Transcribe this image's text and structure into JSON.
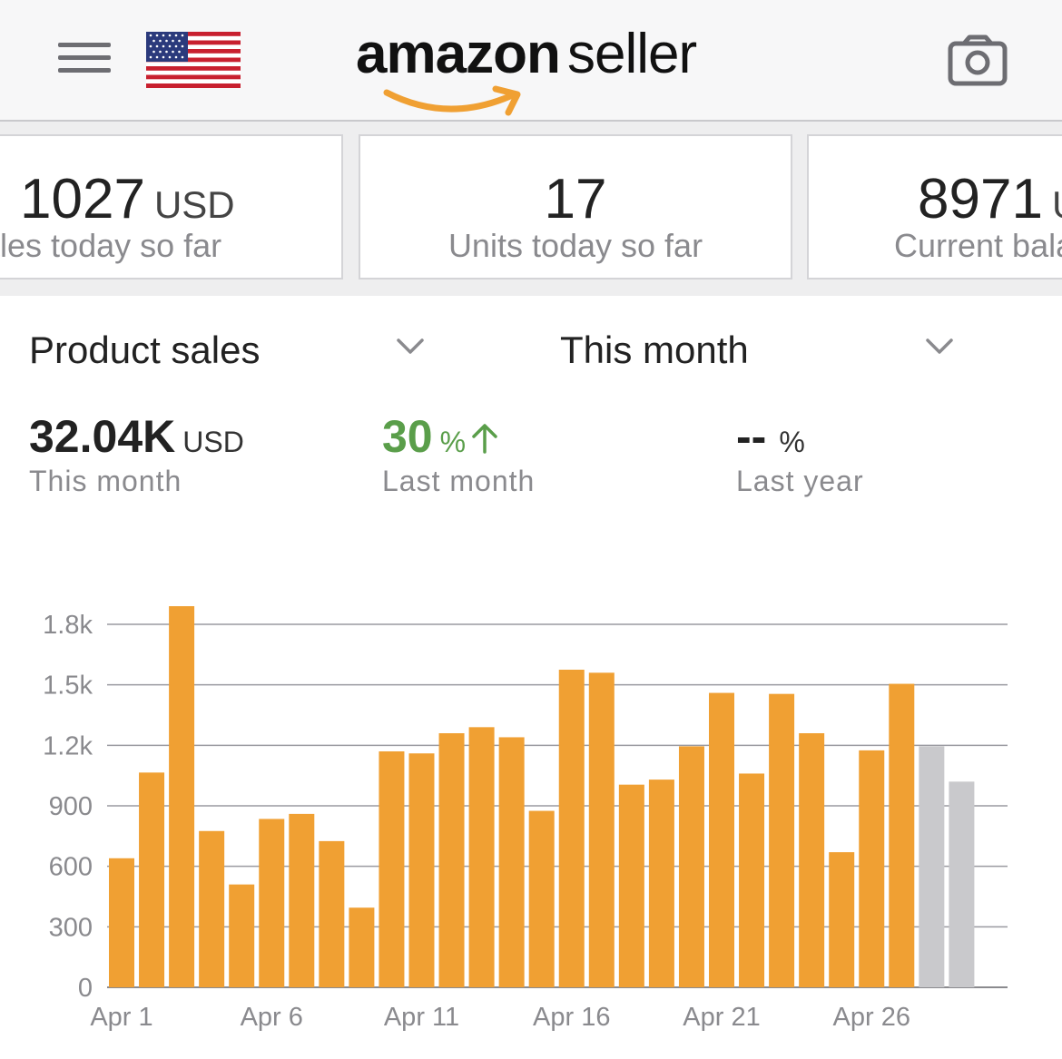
{
  "header": {
    "brand_primary": "amazon",
    "brand_secondary": "seller",
    "icons": [
      "menu-icon",
      "us-flag-icon",
      "camera-icon"
    ],
    "accent": "#f0a033"
  },
  "metrics": [
    {
      "value": "1027",
      "unit": "USD",
      "label": "Sales today so far"
    },
    {
      "value": "17",
      "unit": "",
      "label": "Units today so far"
    },
    {
      "value": "8971",
      "unit": "USD",
      "label": "Current balance"
    }
  ],
  "selectors": {
    "metric": "Product sales",
    "period": "This month"
  },
  "summary": {
    "this_month": {
      "value": "32.04K",
      "unit": "USD",
      "label": "This month"
    },
    "last_month": {
      "value": "30",
      "unit": "%",
      "label": "Last month",
      "trend": "up",
      "color": "#5a9e4a"
    },
    "last_year": {
      "value": "--",
      "unit": "%",
      "label": "Last year"
    }
  },
  "chart_data": {
    "type": "bar",
    "ylim": [
      0,
      1800
    ],
    "yticks": [
      "0",
      "300",
      "600",
      "900",
      "1.2k",
      "1.5k",
      "1.8k"
    ],
    "ytick_values": [
      0,
      300,
      600,
      900,
      1200,
      1500,
      1800
    ],
    "xtick_labels": [
      "Apr 1",
      "Apr 6",
      "Apr 11",
      "Apr 16",
      "Apr 21",
      "Apr 26"
    ],
    "xtick_days": [
      1,
      6,
      11,
      16,
      21,
      26
    ],
    "categories": [
      "Apr 1",
      "Apr 2",
      "Apr 3",
      "Apr 4",
      "Apr 5",
      "Apr 6",
      "Apr 7",
      "Apr 8",
      "Apr 9",
      "Apr 10",
      "Apr 11",
      "Apr 12",
      "Apr 13",
      "Apr 14",
      "Apr 15",
      "Apr 16",
      "Apr 17",
      "Apr 18",
      "Apr 19",
      "Apr 20",
      "Apr 21",
      "Apr 22",
      "Apr 23",
      "Apr 24",
      "Apr 25",
      "Apr 26",
      "Apr 27",
      "Apr 28",
      "Apr 29",
      "Apr 30"
    ],
    "values": [
      640,
      1065,
      1890,
      775,
      510,
      835,
      860,
      725,
      395,
      1170,
      1160,
      1260,
      1290,
      1240,
      875,
      1575,
      1560,
      1005,
      1030,
      1195,
      1460,
      1060,
      1455,
      1260,
      670,
      1175,
      1505,
      1195,
      1020,
      null
    ],
    "projected": [
      false,
      false,
      false,
      false,
      false,
      false,
      false,
      false,
      false,
      false,
      false,
      false,
      false,
      false,
      false,
      false,
      false,
      false,
      false,
      false,
      false,
      false,
      false,
      false,
      false,
      false,
      false,
      true,
      true,
      false
    ],
    "colors": {
      "actual": "#f0a033",
      "projected": "#c9c9cc"
    },
    "grid": true
  }
}
